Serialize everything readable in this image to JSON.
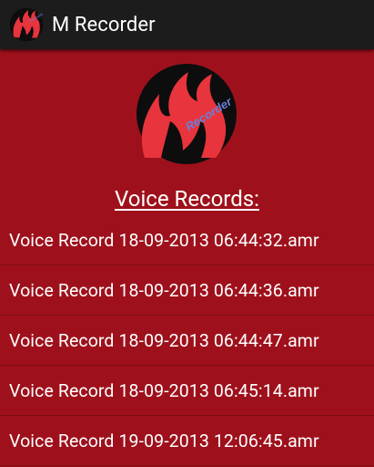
{
  "app": {
    "title": "M Recorder"
  },
  "logo": {
    "badge_text": "Recorder"
  },
  "main": {
    "heading": "Voice Records:",
    "records": [
      {
        "name": "Voice Record 18-09-2013 06:44:32.amr"
      },
      {
        "name": "Voice Record 18-09-2013 06:44:36.amr"
      },
      {
        "name": "Voice Record 18-09-2013 06:44:47.amr"
      },
      {
        "name": "Voice Record 18-09-2013 06:45:14.amr"
      },
      {
        "name": "Voice Record 19-09-2013 12:06:45.amr"
      }
    ]
  },
  "colors": {
    "background": "#9e111c",
    "action_bar": "#1c1c1c",
    "logo_flame": "#e8343c",
    "logo_circle": "#0d0d0d",
    "logo_text": "#6a7fd8"
  },
  "icons": {
    "app_icon": "m-flame-logo-icon",
    "logo": "m-flame-recorder-logo"
  }
}
